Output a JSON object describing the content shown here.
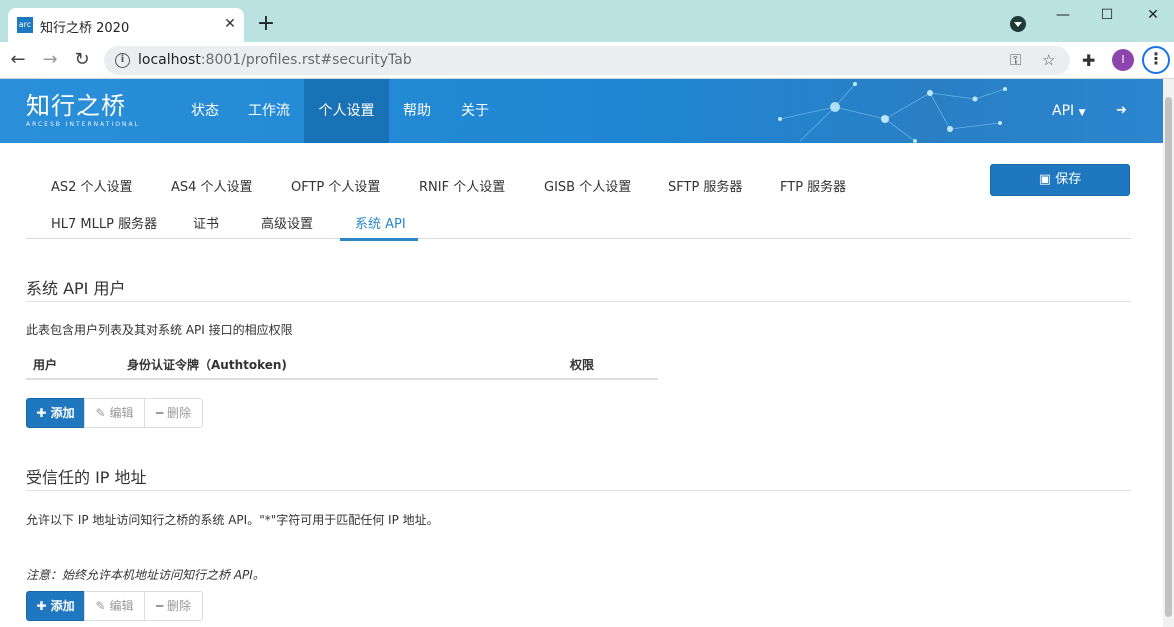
{
  "browser": {
    "tab_title": "知行之桥 2020",
    "favicon_text": "arc",
    "url_host": "localhost",
    "url_rest": ":8001/profiles.rst#securityTab",
    "avatar_letter": "I"
  },
  "header": {
    "logo_cn": "知行之桥",
    "logo_en": "ARCESB INTERNATIONAL",
    "nav": [
      "状态",
      "工作流",
      "个人设置",
      "帮助",
      "关于"
    ],
    "active_nav": "个人设置",
    "api_menu": "API",
    "colors": {
      "header_bg": "#2a8fd8",
      "active_nav_bg": "#1a72b6"
    }
  },
  "subtabs": {
    "row1": [
      "AS2 个人设置",
      "AS4 个人设置",
      "OFTP 个人设置",
      "RNIF 个人设置",
      "GISB 个人设置",
      "SFTP 服务器",
      "FTP 服务器"
    ],
    "row2": [
      "HL7 MLLP 服务器",
      "证书",
      "高级设置",
      "系统 API"
    ],
    "active": "系统 API"
  },
  "save_label": "保存",
  "api_users": {
    "title": "系统 API 用户",
    "description": "此表包含用户列表及其对系统 API 接口的相应权限",
    "columns": [
      "用户",
      "身份认证令牌（Authtoken)",
      "权限"
    ]
  },
  "trusted_ip": {
    "title": "受信任的 IP 地址",
    "description": "允许以下 IP 地址访问知行之桥的系统 API。\"*\"字符可用于匹配任何 IP 地址。",
    "note": "注意：始终允许本机地址访问知行之桥 API。"
  },
  "buttons": {
    "add": "添加",
    "edit": "编辑",
    "delete": "删除"
  },
  "accent_color": "#1f78bf"
}
